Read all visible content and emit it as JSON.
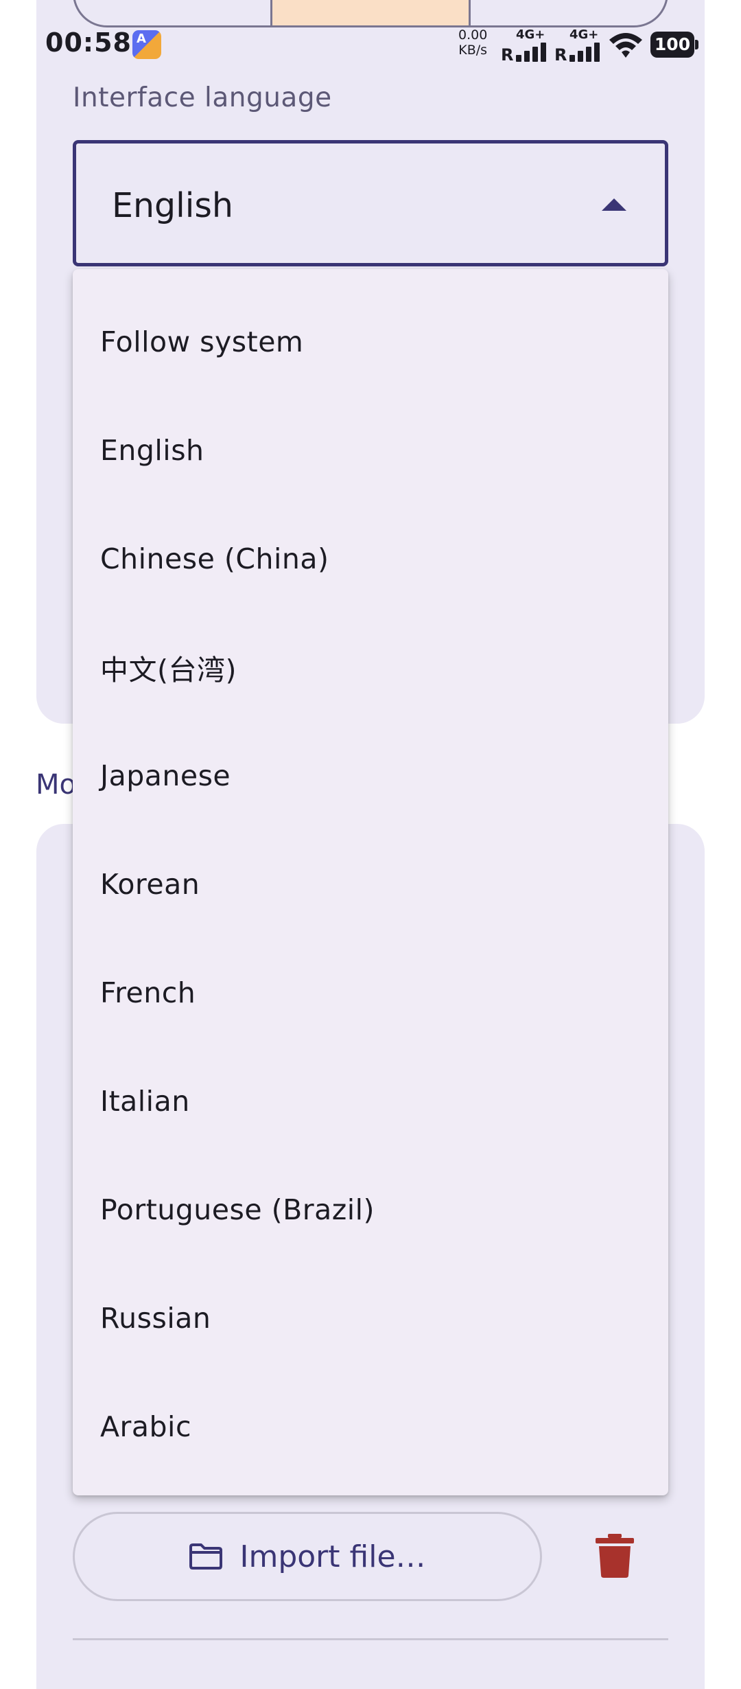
{
  "status_bar": {
    "time": "00:58",
    "speed_value": "0.00",
    "speed_unit": "KB/s",
    "network_1": "4G+",
    "network_2": "4G+",
    "roaming_1": "R",
    "roaming_2": "R",
    "battery": "100"
  },
  "language_setting": {
    "label": "Interface language",
    "selected_value": "English",
    "dropdown_state": "expanded",
    "options": [
      "Follow system",
      "English",
      "Chinese (China)",
      "中文(台湾)",
      "Japanese",
      "Korean",
      "French",
      "Italian",
      "Portuguese (Brazil)",
      "Russian",
      "Arabic"
    ]
  },
  "section_peek": "Mo",
  "import": {
    "label": "Import file…",
    "icon": "folder-icon"
  },
  "delete_icon": "trash-icon",
  "colors": {
    "accent": "#3a3575",
    "card_background": "#ebe8f5",
    "menu_background": "#f1ecf6",
    "segment_selected": "#fadfc6",
    "delete": "#a8322c"
  }
}
